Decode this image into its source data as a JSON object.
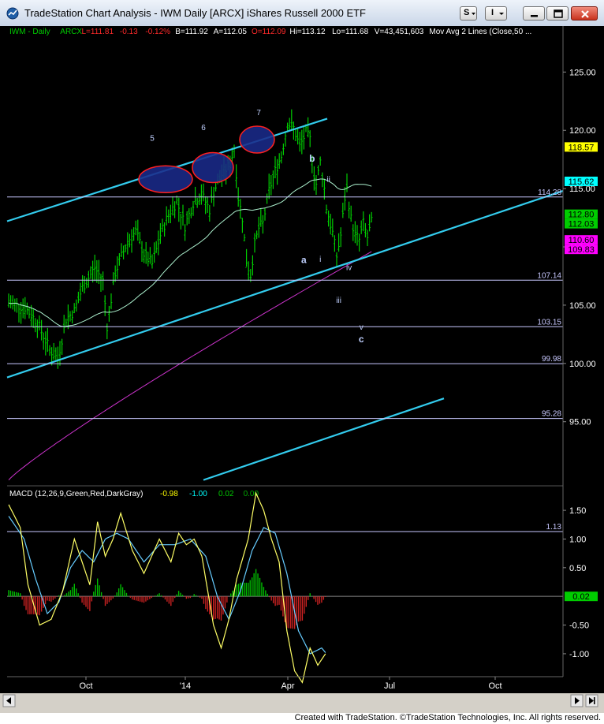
{
  "window": {
    "title": "TradeStation Chart Analysis - IWM Daily [ARCX] iShares Russell 2000 ETF",
    "s_label": "S",
    "i_label": "I"
  },
  "chart": {
    "header_items": [
      {
        "text": "IWM - Daily",
        "color": "#00cc00"
      },
      {
        "text": "ARCX",
        "color": "#00cc00"
      },
      {
        "text": "L=111.81",
        "color": "#ff2a2a"
      },
      {
        "text": "-0.13",
        "color": "#ff2a2a"
      },
      {
        "text": "-0.12%",
        "color": "#ff2a2a"
      },
      {
        "text": "B=111.92",
        "color": "#ffffff"
      },
      {
        "text": "A=112.05",
        "color": "#ffffff"
      },
      {
        "text": "O=112.09",
        "color": "#ff2a2a"
      },
      {
        "text": "Hi=113.12",
        "color": "#ffffff"
      },
      {
        "text": "Lo=111.68",
        "color": "#ffffff"
      },
      {
        "text": "V=43,451,603",
        "color": "#ffffff"
      },
      {
        "text": "Mov Avg 2 Lines (Close,50 ...",
        "color": "#ffffff"
      }
    ],
    "price_axis": [
      "125.00",
      "120.00",
      "115.00",
      "110.00",
      "105.00",
      "100.00",
      "95.00"
    ],
    "price_badges": [
      {
        "text": "118.57",
        "bg": "#ffff00",
        "fg": "#000000",
        "price": 118.57
      },
      {
        "text": "115.62",
        "bg": "#00ffff",
        "fg": "#000000",
        "price": 115.62
      },
      {
        "text": "112.80",
        "bg": "#00cc00",
        "fg": "#000000",
        "price": 112.8
      },
      {
        "text": "112.03",
        "bg": "#00cc00",
        "fg": "#000000",
        "price": 112.03
      },
      {
        "text": "110.60",
        "bg": "#ff00ff",
        "fg": "#000000",
        "price": 110.6
      },
      {
        "text": "109.83",
        "bg": "#ff00ff",
        "fg": "#000000",
        "price": 109.83
      }
    ],
    "horizontal_levels": [
      {
        "label": "114.28",
        "price": 114.28
      },
      {
        "label": "107.14",
        "price": 107.14
      },
      {
        "label": "103.15",
        "price": 103.15
      },
      {
        "label": "99.98",
        "price": 99.98
      },
      {
        "label": "95.28",
        "price": 95.28
      }
    ],
    "wave_labels": [
      {
        "text": "5",
        "price": 119.1,
        "date_index": 70
      },
      {
        "text": "6",
        "price": 120.0,
        "date_index": 95
      },
      {
        "text": "7",
        "price": 121.3,
        "date_index": 122
      },
      {
        "text": "b",
        "price": 117.3,
        "date_index": 148
      },
      {
        "text": "ii",
        "price": 115.6,
        "date_index": 156
      },
      {
        "text": "a",
        "price": 108.6,
        "date_index": 144
      },
      {
        "text": "i",
        "price": 108.7,
        "date_index": 152
      },
      {
        "text": "iv",
        "price": 108.0,
        "date_index": 166
      },
      {
        "text": "iii",
        "price": 105.2,
        "date_index": 161
      },
      {
        "text": "v",
        "price": 102.9,
        "date_index": 172
      },
      {
        "text": "c",
        "price": 101.8,
        "date_index": 172
      }
    ],
    "date_axis": [
      "Oct",
      "'14",
      "Apr",
      "Jul",
      "Oct"
    ],
    "macd": {
      "title": "MACD (12,26,9,Green,Red,DarkGray)",
      "values": [
        {
          "text": "-0.98",
          "color": "#ffff00"
        },
        {
          "text": "-1.00",
          "color": "#00ffff"
        },
        {
          "text": "0.02",
          "color": "#00cc00"
        },
        {
          "text": "0.00",
          "color": "#00aa00"
        }
      ],
      "axis": [
        "1.50",
        "1.00",
        "0.50",
        "-0.50",
        "-1.00"
      ],
      "level_label": "1.13",
      "badge": "0.02"
    }
  },
  "footer": {
    "text": "Created with TradeStation. ©TradeStation Technologies, Inc. All rights reserved."
  },
  "colors": {
    "price_bars": "#00cc00",
    "channel_lines": "#33ccee",
    "ma50": "#aaeecc",
    "ma200": "#cc33cc",
    "ellipse_fill": "#1a2a8a",
    "ellipse_stroke": "#ff2020",
    "macd_line": "#ffff66",
    "signal_line": "#66ccff",
    "hist_pos": "#00bb00",
    "hist_neg": "#cc2222"
  }
}
